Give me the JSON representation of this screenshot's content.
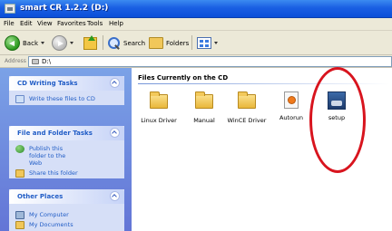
{
  "window": {
    "title": "smart CR 1.2.2 (D:)"
  },
  "menu": {
    "items": [
      "File",
      "Edit",
      "View",
      "Favorites",
      "Tools",
      "Help"
    ]
  },
  "toolbar": {
    "back_label": "Back",
    "search_label": "Search",
    "folders_label": "Folders"
  },
  "address": {
    "label": "Address",
    "value": "D:\\"
  },
  "taskpane": {
    "sections": [
      {
        "title": "CD Writing Tasks",
        "items": [
          {
            "label": "Write these files to CD",
            "icon": "cd-write-icon"
          }
        ]
      },
      {
        "title": "File and Folder Tasks",
        "items": [
          {
            "label": "Publish this folder to the Web",
            "icon": "globe-icon"
          },
          {
            "label": "Share this folder",
            "icon": "share-folder-icon"
          }
        ]
      },
      {
        "title": "Other Places",
        "items": [
          {
            "label": "My Computer",
            "icon": "computer-icon"
          },
          {
            "label": "My Documents",
            "icon": "documents-icon"
          }
        ]
      }
    ]
  },
  "content": {
    "group_title": "Files Currently on the CD",
    "files": [
      {
        "name": "Linux Driver",
        "type": "folder"
      },
      {
        "name": "Manual",
        "type": "folder"
      },
      {
        "name": "WinCE Driver",
        "type": "folder"
      },
      {
        "name": "Autorun",
        "type": "autorun"
      },
      {
        "name": "setup",
        "type": "setup"
      }
    ]
  },
  "annotation": {
    "color": "#d8141e"
  }
}
